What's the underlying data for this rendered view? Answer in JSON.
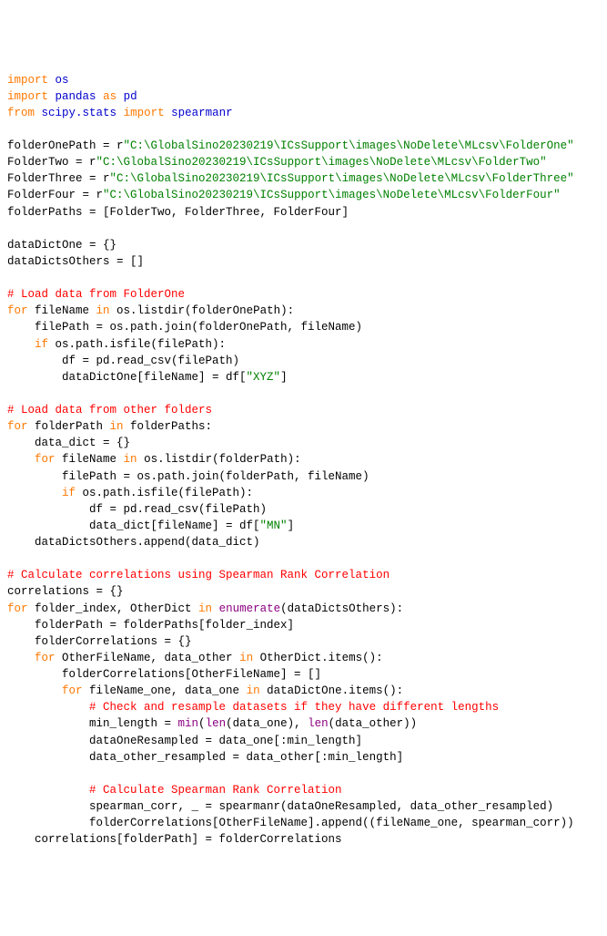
{
  "lines": {
    "l1a": "import",
    "l1b": "os",
    "l2a": "import",
    "l2b": "pandas",
    "l2c": "as",
    "l2d": "pd",
    "l3a": "from",
    "l3b": "scipy.stats",
    "l3c": "import",
    "l3d": "spearmanr",
    "blank": "",
    "fop": "folderOnePath = r",
    "fop_s": "\"C:\\GlobalSino20230219\\ICsSupport\\images\\NoDelete\\MLcsv\\FolderOne\"",
    "f2": "FolderTwo = r",
    "f2_s": "\"C:\\GlobalSino20230219\\ICsSupport\\images\\NoDelete\\MLcsv\\FolderTwo\"",
    "f3": "FolderThree = r",
    "f3_s": "\"C:\\GlobalSino20230219\\ICsSupport\\images\\NoDelete\\MLcsv\\FolderThree\"",
    "f4": "FolderFour = r",
    "f4_s": "\"C:\\GlobalSino20230219\\ICsSupport\\images\\NoDelete\\MLcsv\\FolderFour\"",
    "fp": "folderPaths = [FolderTwo, FolderThree, FolderFour]",
    "ddo": "dataDictOne = {}",
    "ddoth": "dataDictsOthers = []",
    "c1": "# Load data from FolderOne",
    "for1": "for",
    "for1b": " fileName ",
    "in1": "in",
    "for1c": " os.listdir(folderOnePath):",
    "l_fp": "    filePath = os.path.join(folderOnePath, fileName)",
    "if1a": "    ",
    "if1": "if",
    "if1b": " os.path.isfile(filePath):",
    "l_df": "        df = pd.read_csv(filePath)",
    "l_assign": "        dataDictOne[fileName] = df[",
    "xyz": "\"XYZ\"",
    "l_assign2": "]",
    "c2": "# Load data from other folders",
    "for2": "for",
    "for2b": " folderPath ",
    "in2": "in",
    "for2c": " folderPaths:",
    "l_dd": "    data_dict = {}",
    "for3a": "    ",
    "for3": "for",
    "for3b": " fileName ",
    "in3": "in",
    "for3c": " os.listdir(folderPath):",
    "l_fp2": "        filePath = os.path.join(folderPath, fileName)",
    "if2a": "        ",
    "if2": "if",
    "if2b": " os.path.isfile(filePath):",
    "l_df2": "            df = pd.read_csv(filePath)",
    "l_a2a": "            data_dict[fileName] = df[",
    "mn": "\"MN\"",
    "l_a2b": "]",
    "l_app": "    dataDictsOthers.append(data_dict)",
    "c3": "# Calculate correlations using Spearman Rank Correlation",
    "corr": "correlations = {}",
    "for4": "for",
    "for4b": " folder_index, OtherDict ",
    "in4": "in",
    "for4c": " ",
    "enum": "enumerate",
    "for4d": "(dataDictsOthers):",
    "l_fpath": "    folderPath = folderPaths[folder_index]",
    "l_fc": "    folderCorrelations = {}",
    "for5a": "    ",
    "for5": "for",
    "for5b": " OtherFileName, data_other ",
    "in5": "in",
    "for5c": " OtherDict.items():",
    "l_fc2": "        folderCorrelations[OtherFileName] = []",
    "for6a": "        ",
    "for6": "for",
    "for6b": " fileName_one, data_one ",
    "in6": "in",
    "for6c": " dataDictOne.items():",
    "c4": "            # Check and resample datasets if they have different lengths",
    "l_min_a": "            min_length = ",
    "min": "min",
    "l_min_b": "(",
    "len1": "len",
    "l_min_c": "(data_one), ",
    "len2": "len",
    "l_min_d": "(data_other))",
    "l_dor": "            dataOneResampled = data_one[:min_length]",
    "l_dor2": "            data_other_resampled = data_other[:min_length]",
    "c5": "            # Calculate Spearman Rank Correlation",
    "l_sp": "            spearman_corr, _ = spearmanr(dataOneResampled, data_other_resampled)",
    "l_app2": "            folderCorrelations[OtherFileName].append((fileName_one, spearman_corr))",
    "l_last": "    correlations[folderPath] = folderCorrelations"
  }
}
